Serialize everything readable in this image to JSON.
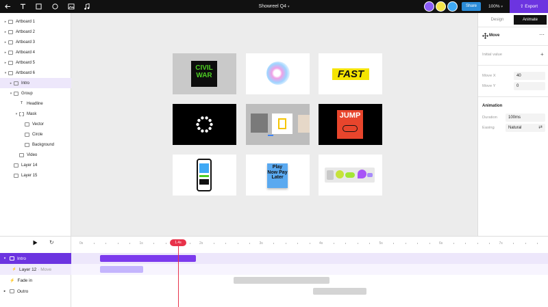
{
  "topbar": {
    "title": "Showreel Q4",
    "share_label": "Share",
    "zoom": "100%",
    "export_label": "Export",
    "tools": [
      "back-arrow-icon",
      "text-tool-icon",
      "rectangle-tool-icon",
      "ellipse-tool-icon",
      "image-tool-icon",
      "audio-tool-icon"
    ]
  },
  "layers": [
    {
      "label": "Artboard 1",
      "depth": 0,
      "chevron": "▸",
      "icon": "frame"
    },
    {
      "label": "Artboard 2",
      "depth": 0,
      "chevron": "▸",
      "icon": "frame"
    },
    {
      "label": "Artboard 3",
      "depth": 0,
      "chevron": "▸",
      "icon": "frame"
    },
    {
      "label": "Artboard 4",
      "depth": 0,
      "chevron": "▸",
      "icon": "frame"
    },
    {
      "label": "Artboard 5",
      "depth": 0,
      "chevron": "▸",
      "icon": "frame"
    },
    {
      "label": "Artboard 6",
      "depth": 0,
      "chevron": "▾",
      "icon": "frame"
    },
    {
      "label": "Intro",
      "depth": 1,
      "chevron": "▸",
      "icon": "group",
      "selected": true
    },
    {
      "label": "Group",
      "depth": 1,
      "chevron": "▾",
      "icon": "group"
    },
    {
      "label": "Headline",
      "depth": 2,
      "chevron": "",
      "icon": "text"
    },
    {
      "label": "Mask",
      "depth": 2,
      "chevron": "▾",
      "icon": "mask"
    },
    {
      "label": "Vector",
      "depth": 3,
      "chevron": "",
      "icon": "shape"
    },
    {
      "label": "Circle",
      "depth": 3,
      "chevron": "",
      "icon": "shape"
    },
    {
      "label": "Background",
      "depth": 3,
      "chevron": "",
      "icon": "shape"
    },
    {
      "label": "Video",
      "depth": 2,
      "chevron": "",
      "icon": "video"
    },
    {
      "label": "Layer 14",
      "depth": 1,
      "chevron": "",
      "icon": "shape"
    },
    {
      "label": "Layer 15",
      "depth": 1,
      "chevron": "",
      "icon": "shape"
    }
  ],
  "artboards": {
    "a1_line1": "CIVIL",
    "a1_line2": "WAR",
    "a3_text": "FAST",
    "a6_text": "JUMP",
    "a8_text": "Play Now Pay Later"
  },
  "props": {
    "tab_design": "Design",
    "tab_animate": "Animate",
    "section_move": "Move",
    "initial_value": "Initial value",
    "move_x_label": "Move X",
    "move_x_value": "40",
    "move_y_label": "Move Y",
    "move_y_value": "0",
    "animation_heading": "Animation",
    "duration_label": "Duration",
    "duration_value": "100ms",
    "easing_label": "Easing",
    "easing_value": "Natural"
  },
  "timeline": {
    "playhead_label": "1.4s",
    "ticks": [
      "0s",
      "1s",
      "2s",
      "3s",
      "4s",
      "5s",
      "6s",
      "7s"
    ],
    "rows": [
      {
        "label": "Intro",
        "prefix": "▾",
        "style": "active"
      },
      {
        "label": "Layer 12",
        "suffix": "· Move",
        "style": "sub"
      },
      {
        "label": "Fade in",
        "prefix": "",
        "style": "plain"
      },
      {
        "label": "Outro",
        "prefix": "▸",
        "style": "plain"
      }
    ]
  },
  "colors": {
    "accent": "#6c34e0",
    "share": "#2b8cd8",
    "playhead": "#e8324a",
    "fast_yellow": "#f5e400",
    "civil_green": "#4ccc23",
    "jump_red": "#e8452c"
  }
}
